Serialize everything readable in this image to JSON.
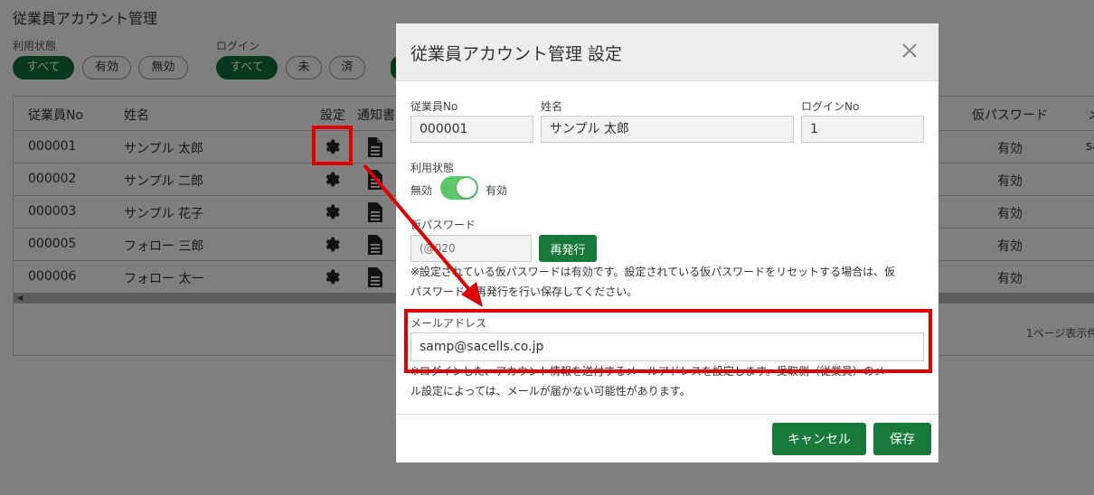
{
  "page": {
    "title": "従業員アカウント管理",
    "filters": {
      "status": {
        "label": "利用状態",
        "options": [
          "すべて",
          "有効",
          "無効"
        ]
      },
      "login": {
        "label": "ログイン",
        "options": [
          "すべて",
          "未",
          "済"
        ]
      }
    },
    "table": {
      "headers": {
        "no": "従業員No",
        "name": "姓名",
        "settings": "設定",
        "notice": "通知書",
        "temp_password": "仮パスワード",
        "mail": "メ"
      },
      "rows": [
        {
          "no": "000001",
          "name": "サンプル 太郎",
          "temp": "有効",
          "mail": "sa"
        },
        {
          "no": "000002",
          "name": "サンプル 二郎",
          "temp": "有効",
          "mail": ""
        },
        {
          "no": "000003",
          "name": "サンプル 花子",
          "temp": "有効",
          "mail": ""
        },
        {
          "no": "000005",
          "name": "フォロー 三郎",
          "temp": "有効",
          "mail": ""
        },
        {
          "no": "000006",
          "name": "フォロー 太一",
          "temp": "有効",
          "mail": ""
        }
      ],
      "pager_text": "1ページ表示件"
    }
  },
  "modal": {
    "title": "従業員アカウント管理 設定",
    "employee_no": {
      "label": "従業員No",
      "value": "000001"
    },
    "full_name": {
      "label": "姓名",
      "value": "サンプル 太郎"
    },
    "login_no": {
      "label": "ログインNo",
      "value": "1"
    },
    "status": {
      "label": "利用状態",
      "off_label": "無効",
      "on_label": "有効",
      "enabled": true
    },
    "temp_password": {
      "label": "仮パスワード",
      "value": "(@020",
      "reissue_label": "再発行",
      "note_line1": "※設定されている仮パスワードは有効です。設定されている仮パスワードをリセットする場合は、仮",
      "note_line2": "パスワードの再発行を行い保存してください。"
    },
    "email": {
      "label": "メールアドレス",
      "value": "samp@sacells.co.jp",
      "note_line1": "※ログインした、アカウント情報を送付するメールアドレスを設定します。受取側（従業員）のメー",
      "note_line2": "ル設定によっては、メールが届かない可能性があります。"
    },
    "cancel_label": "キャンセル",
    "save_label": "保存"
  },
  "colors": {
    "primary_green": "#177a3a",
    "toggle_on": "#5cc86b",
    "annotation_red": "#e00000"
  }
}
